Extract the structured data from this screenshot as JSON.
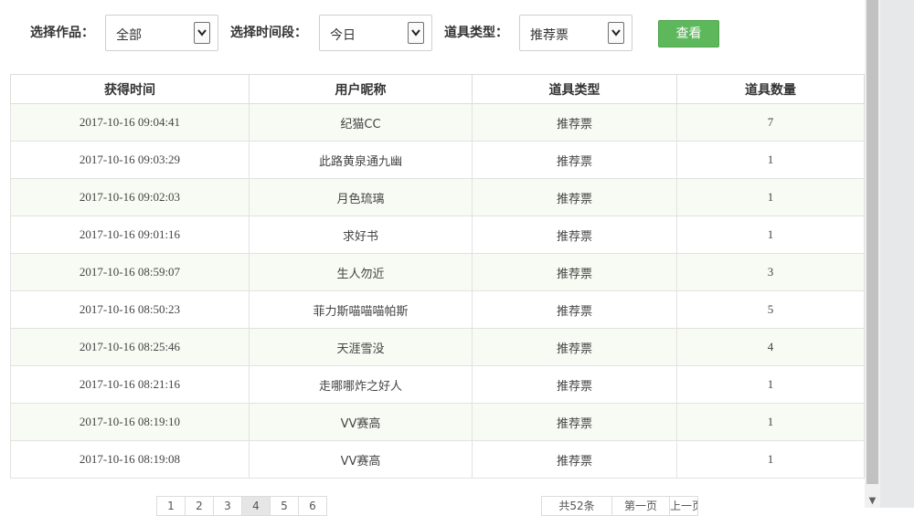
{
  "filters": {
    "work_label": "选择作品：",
    "work_value": "全部",
    "period_label": "选择时间段：",
    "period_value": "今日",
    "type_label": "道具类型：",
    "type_value": "推荐票",
    "view_button": "查看"
  },
  "table": {
    "headers": [
      "获得时间",
      "用户昵称",
      "道具类型",
      "道具数量"
    ],
    "rows": [
      [
        "2017-10-16 09:04:41",
        "纪猫CC",
        "推荐票",
        "7"
      ],
      [
        "2017-10-16 09:03:29",
        "此路黄泉通九幽",
        "推荐票",
        "1"
      ],
      [
        "2017-10-16 09:02:03",
        "月色琉璃",
        "推荐票",
        "1"
      ],
      [
        "2017-10-16 09:01:16",
        "求好书",
        "推荐票",
        "1"
      ],
      [
        "2017-10-16 08:59:07",
        "生人勿近",
        "推荐票",
        "3"
      ],
      [
        "2017-10-16 08:50:23",
        "菲力斯喵喵喵帕斯",
        "推荐票",
        "5"
      ],
      [
        "2017-10-16 08:25:46",
        "天涯雪没",
        "推荐票",
        "4"
      ],
      [
        "2017-10-16 08:21:16",
        "走哪哪炸之好人",
        "推荐票",
        "1"
      ],
      [
        "2017-10-16 08:19:10",
        "VV赛高",
        "推荐票",
        "1"
      ],
      [
        "2017-10-16 08:19:08",
        "VV赛高",
        "推荐票",
        "1"
      ]
    ]
  },
  "pager": {
    "total": "共52条",
    "first": "第一页",
    "prev": "上一页",
    "pages": [
      "1",
      "2",
      "3",
      "4",
      "5",
      "6"
    ],
    "current": "4"
  },
  "colors": {
    "accent_green": "#5db85c",
    "row_tint": "#f8fbf3"
  }
}
